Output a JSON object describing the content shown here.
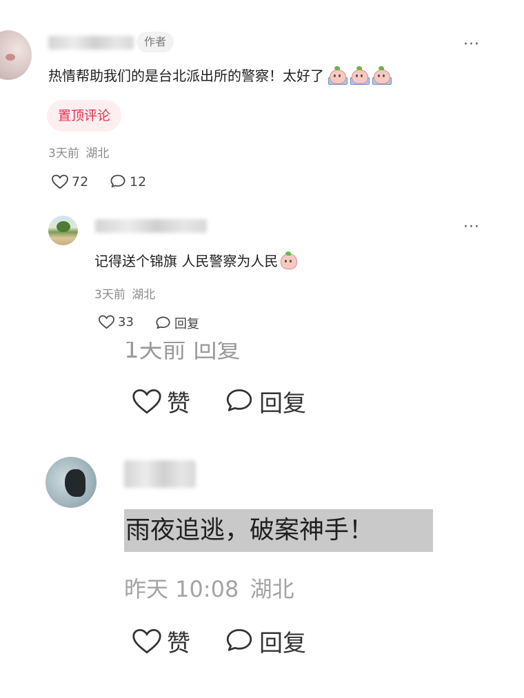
{
  "top_comment": {
    "author_tag": "作者",
    "text": "热情帮助我们的是台北派出所的警察！太好了",
    "emojis": [
      "peach-emoji",
      "peach-emoji",
      "peach-emoji"
    ],
    "pin_label": "置顶评论",
    "time": "3天前",
    "location": "湖北",
    "likes": "72",
    "replies": "12",
    "more": "···"
  },
  "reply": {
    "text": "记得送个锦旗 人民警察为人民",
    "emoji": "peach-emoji",
    "time": "3天前",
    "location": "湖北",
    "likes": "33",
    "reply_label": "回复",
    "more": "···"
  },
  "zoomed": {
    "cut_text": "1天前 回复",
    "like_label": "赞",
    "reply_label": "回复",
    "comment": {
      "text": "雨夜追逃，破案神手！",
      "time": "昨天 10:08",
      "location": "湖北",
      "like_label": "赞",
      "reply_label": "回复"
    }
  },
  "colors": {
    "pin_badge_text": "#e8314e",
    "pin_badge_bg": "#fdeef0",
    "highlight_bg": "#c9c9c9",
    "meta_text": "#8a8a8a"
  }
}
